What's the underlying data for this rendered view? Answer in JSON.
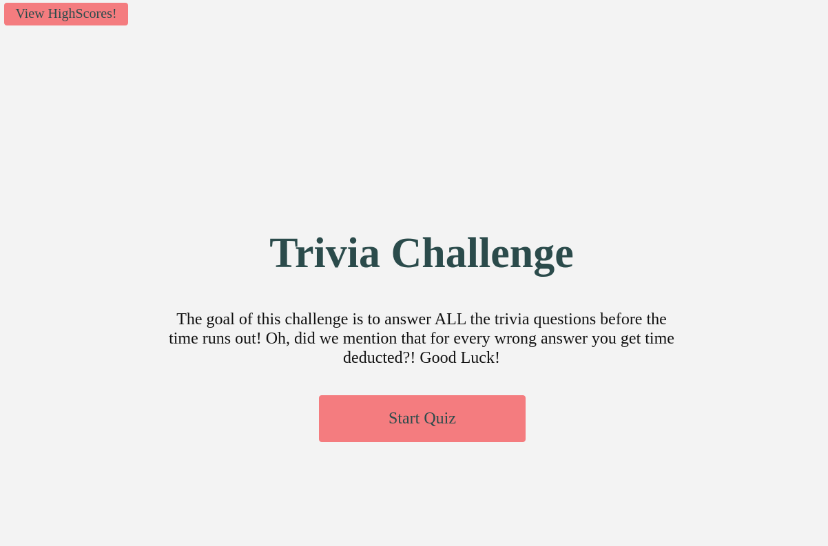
{
  "header": {
    "highscores_label": "View HighScores!"
  },
  "main": {
    "title": "Trivia Challenge",
    "description": "The goal of this challenge is to answer ALL the trivia questions before the time runs out! Oh, did we mention that for every wrong answer you get time deducted?! Good Luck!",
    "start_label": "Start Quiz"
  },
  "colors": {
    "background": "#f3f3f3",
    "button": "#f47c7f",
    "heading": "#2b4b4b",
    "body_text": "#111111"
  }
}
